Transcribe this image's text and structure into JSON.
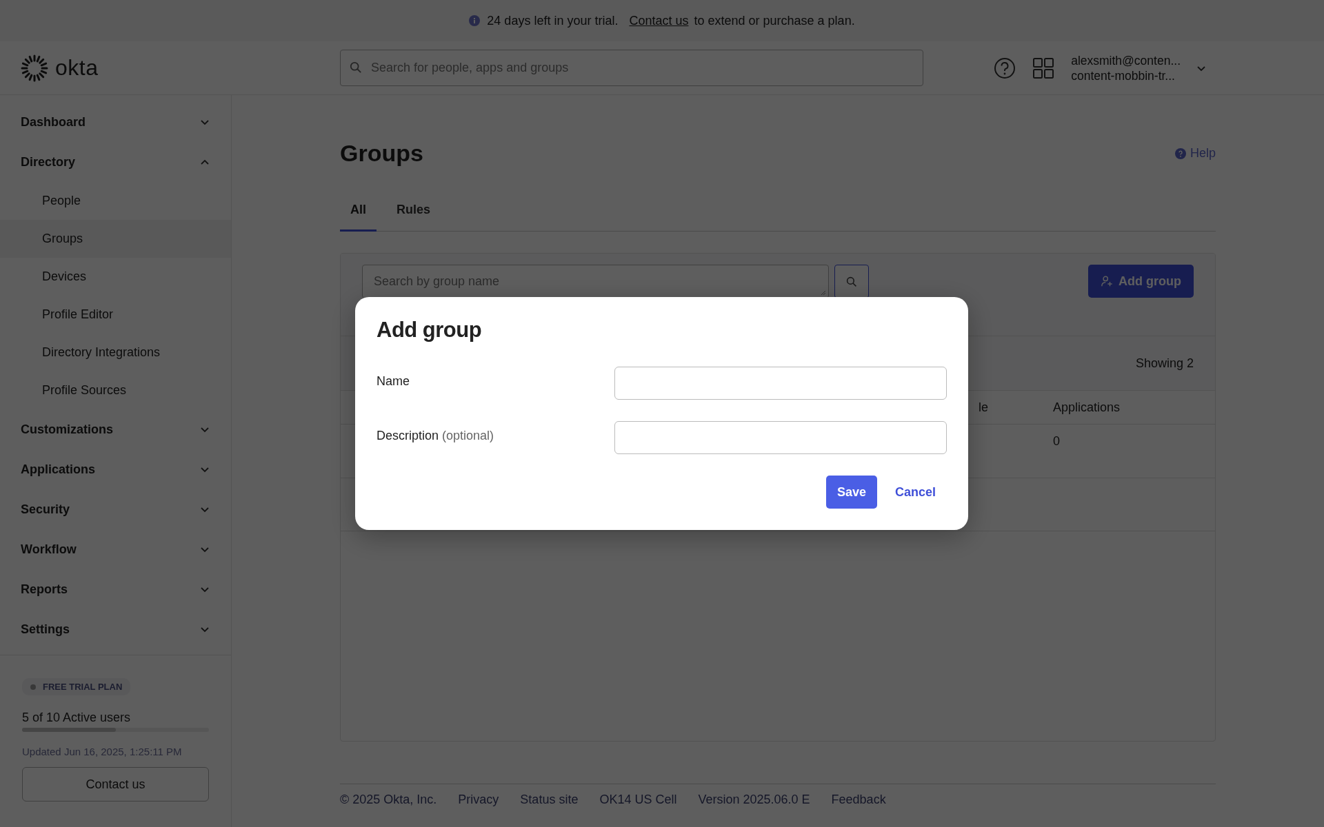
{
  "trial_banner": {
    "text": "24 days left in your trial.",
    "link": "Contact us",
    "suffix": "to extend or purchase a plan."
  },
  "header": {
    "logo": "okta",
    "search": {
      "placeholder": "Search for people, apps and groups"
    },
    "user": {
      "email": "alexsmith@conten...",
      "org": "content-mobbin-tr..."
    }
  },
  "sidebar": {
    "items": [
      {
        "label": "Dashboard",
        "expanded": false
      },
      {
        "label": "Directory",
        "expanded": true,
        "children": [
          {
            "label": "People",
            "selected": false
          },
          {
            "label": "Groups",
            "selected": true
          },
          {
            "label": "Devices",
            "selected": false
          },
          {
            "label": "Profile Editor",
            "selected": false
          },
          {
            "label": "Directory Integrations",
            "selected": false
          },
          {
            "label": "Profile Sources",
            "selected": false
          }
        ]
      },
      {
        "label": "Customizations",
        "expanded": false
      },
      {
        "label": "Applications",
        "expanded": false
      },
      {
        "label": "Security",
        "expanded": false
      },
      {
        "label": "Workflow",
        "expanded": false
      },
      {
        "label": "Reports",
        "expanded": false
      },
      {
        "label": "Settings",
        "expanded": false
      }
    ]
  },
  "plan": {
    "badge": "FREE TRIAL PLAN",
    "users": "5 of 10 Active users",
    "level": 0.5,
    "updated": "Updated Jun 16, 2025, 1:25:11 PM",
    "button": "Contact us"
  },
  "page": {
    "title": "Groups",
    "help": "Help",
    "tabs": [
      {
        "label": "All",
        "selected": true
      },
      {
        "label": "Rules",
        "selected": false
      }
    ],
    "search": {
      "placeholder": "Search by group name"
    },
    "add_button": "Add group",
    "showing": "Showing 2",
    "table": {
      "columns": [
        "le",
        "Applications"
      ],
      "rows": [
        {
          "applications": "0"
        }
      ]
    }
  },
  "footer": [
    "© 2025 Okta, Inc.",
    "Privacy",
    "Status site",
    "OK14 US Cell",
    "Version 2025.06.0 E",
    "Feedback"
  ],
  "dialog": {
    "title": "Add group",
    "fields": [
      {
        "label": "Name"
      },
      {
        "label": "Description",
        "hint": "(optional)"
      }
    ],
    "save": "Save",
    "cancel": "Cancel"
  }
}
